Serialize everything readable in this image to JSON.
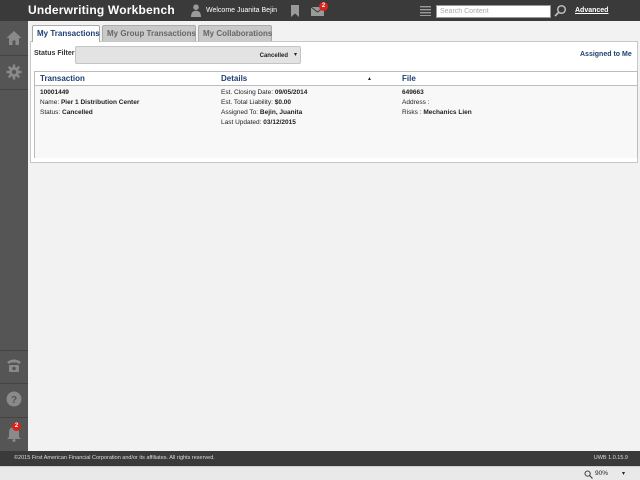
{
  "header": {
    "app_title": "Underwriting Workbench",
    "welcome_text": "Welcome Juanita Bejin",
    "mail_badge_count": "2",
    "search_placeholder": "Search Content",
    "advanced_label": "Advanced"
  },
  "sidebar": {
    "icons": [
      "home-icon",
      "gear-icon",
      "phone-icon",
      "help-icon",
      "bell-icon"
    ],
    "notification_badge": "2"
  },
  "tabs": [
    {
      "label": "My Transactions",
      "active": true
    },
    {
      "label": "My Group Transactions",
      "active": false
    },
    {
      "label": "My Collaborations",
      "active": false
    }
  ],
  "filter": {
    "label": "Status Filter:",
    "selected": "Cancelled",
    "assigned_label": "Assigned to Me"
  },
  "table": {
    "columns": [
      "Transaction",
      "Details",
      "File"
    ],
    "rows": [
      {
        "transaction_id": "10001449",
        "name_label": "Name:",
        "name_value": "Pier 1 Distribution Center",
        "status_label": "Status:",
        "status_value": "Cancelled",
        "closing_label": "Est. Closing Date:",
        "closing_value": "09/05/2014",
        "liability_label": "Est. Total Liability:",
        "liability_value": "$0.00",
        "assigned_label": "Assigned To:",
        "assigned_value": "Bejin, Juanita",
        "updated_label": "Last Updated:",
        "updated_value": "03/12/2015",
        "file_number": "649663",
        "address_label": "Address :",
        "address_value": "",
        "risks_label": "Risks :",
        "risks_value": "Mechanics Lien"
      }
    ]
  },
  "footer": {
    "copyright": "©2015 First American Financial Corporation and/or its affiliates. All rights reserved.",
    "version": "UWB 1.0.15.9"
  },
  "statusbar": {
    "zoom": "90%"
  },
  "colors": {
    "topbar": "#3a3a3a",
    "sidebar": "#555555",
    "accent": "#1c3f74",
    "badge": "#d9231d"
  }
}
